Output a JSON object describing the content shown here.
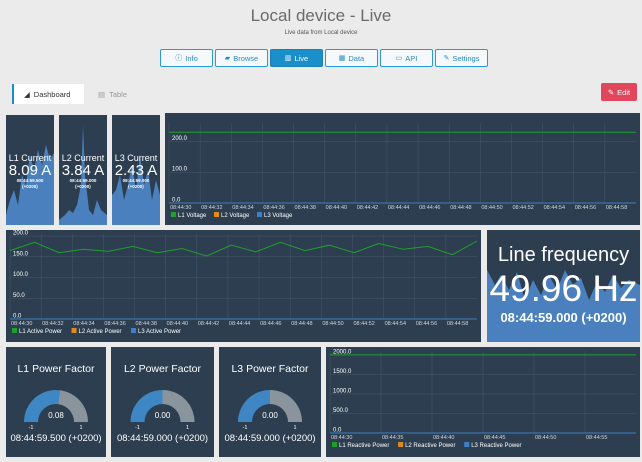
{
  "header": {
    "title": "Local device - Live",
    "subtitle": "Live data from Local device"
  },
  "nav": [
    {
      "label": "Info",
      "icon": "info-icon"
    },
    {
      "label": "Browse",
      "icon": "folder-icon"
    },
    {
      "label": "Live",
      "icon": "bar-chart-icon"
    },
    {
      "label": "Data",
      "icon": "table-icon"
    },
    {
      "label": "API",
      "icon": "api-icon"
    },
    {
      "label": "Settings",
      "icon": "wrench-icon"
    }
  ],
  "tabs": {
    "dashboard": "Dashboard",
    "table": "Table",
    "edit": "Edit"
  },
  "colors": {
    "panel": "#2d3e50",
    "accent": "#1a8fc9",
    "l1": "#1fa02a",
    "l2": "#e08a1b",
    "l3": "#3f7fc6",
    "gauge_fill": "#3f86c4",
    "gauge_bg": "#8a949c"
  },
  "currents": [
    {
      "title": "L1 Current",
      "value": "8.09 A",
      "time": "08:44:59.500",
      "tz": "(+0200)"
    },
    {
      "title": "L2 Current",
      "value": "3.84 A",
      "time": "08:44:59.000",
      "tz": "(+0200)"
    },
    {
      "title": "L3 Current",
      "value": "2.43 A",
      "time": "08:44:59.000",
      "tz": "(+0200)"
    }
  ],
  "frequency": {
    "title": "Line frequency",
    "value": "49.96 Hz",
    "timestamp": "08:44:59.000 (+0200)"
  },
  "power_factors": [
    {
      "title": "L1 Power Factor",
      "value": "0.08",
      "min": "-1",
      "max": "1",
      "timestamp": "08:44:59.500 (+0200)",
      "fraction": 0.54
    },
    {
      "title": "L2 Power Factor",
      "value": "0.00",
      "min": "-1",
      "max": "1",
      "timestamp": "08:44:59.000 (+0200)",
      "fraction": 0.5
    },
    {
      "title": "L3 Power Factor",
      "value": "0.00",
      "min": "-1",
      "max": "1",
      "timestamp": "08:44:59.000 (+0200)",
      "fraction": 0.5
    }
  ],
  "chart_data": [
    {
      "type": "line",
      "x": [
        "08:44:30",
        "08:44:32",
        "08:44:34",
        "08:44:36",
        "08:44:38",
        "08:44:40",
        "08:44:42",
        "08:44:44",
        "08:44:46",
        "08:44:48",
        "08:44:50",
        "08:44:52",
        "08:44:54",
        "08:44:56",
        "08:44:58"
      ],
      "yticks": [
        "0.0",
        "100.0",
        "200.0"
      ],
      "ylim": [
        0,
        260
      ],
      "series": [
        {
          "name": "L1 Voltage",
          "values": [
            230,
            230,
            230,
            230,
            230,
            230,
            230,
            230,
            230,
            230,
            230,
            230,
            230,
            230,
            230
          ]
        },
        {
          "name": "L2 Voltage",
          "values": [
            0,
            0,
            0,
            0,
            0,
            0,
            0,
            0,
            0,
            0,
            0,
            0,
            0,
            0,
            0
          ]
        },
        {
          "name": "L3 Voltage",
          "values": [
            0,
            0,
            0,
            0,
            0,
            0,
            0,
            0,
            0,
            0,
            0,
            0,
            0,
            0,
            0
          ]
        }
      ],
      "legend": "bottom-left",
      "grid": true
    },
    {
      "type": "line",
      "x": [
        "08:44:30",
        "08:44:32",
        "08:44:34",
        "08:44:36",
        "08:44:38",
        "08:44:40",
        "08:44:42",
        "08:44:44",
        "08:44:46",
        "08:44:48",
        "08:44:50",
        "08:44:52",
        "08:44:54",
        "08:44:56",
        "08:44:58"
      ],
      "yticks": [
        "0.0",
        "50.0",
        "100.0",
        "150.0",
        "200.0"
      ],
      "ylim": [
        0,
        205
      ],
      "series": [
        {
          "name": "L1 Active Power",
          "values": [
            165,
            185,
            160,
            168,
            163,
            175,
            160,
            170,
            152,
            178,
            162,
            185,
            165,
            178,
            160,
            182,
            168,
            175,
            155,
            188
          ]
        },
        {
          "name": "L2 Active Power",
          "values": [
            0,
            0,
            0,
            0,
            0,
            0,
            0,
            0,
            0,
            0,
            0,
            0,
            0,
            0,
            0,
            0,
            0,
            0,
            0,
            0
          ]
        },
        {
          "name": "L3 Active Power",
          "values": [
            0,
            0,
            0,
            0,
            0,
            0,
            0,
            0,
            0,
            0,
            0,
            0,
            0,
            0,
            0,
            0,
            0,
            0,
            0,
            0
          ]
        }
      ],
      "legend": "bottom-left",
      "grid": true
    },
    {
      "type": "line",
      "x": [
        "08:44:30",
        "08:44:35",
        "08:44:40",
        "08:44:45",
        "08:44:50",
        "08:44:55"
      ],
      "yticks": [
        "0.0",
        "500.0",
        "1000.0",
        "1500.0",
        "2000.0"
      ],
      "ylim": [
        0,
        2100
      ],
      "series": [
        {
          "name": "L1 Reactive Power",
          "values": [
            2000,
            2000,
            2000,
            2000,
            2000,
            2000,
            2000
          ]
        },
        {
          "name": "L2 Reactive Power",
          "values": [
            0,
            0,
            0,
            0,
            0,
            0,
            0
          ]
        },
        {
          "name": "L3 Reactive Power",
          "values": [
            0,
            0,
            0,
            0,
            0,
            0,
            0
          ]
        }
      ],
      "legend": "bottom-left",
      "grid": true
    }
  ]
}
